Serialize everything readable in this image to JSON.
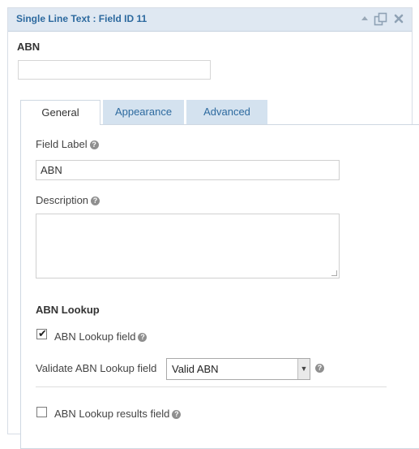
{
  "panel": {
    "title": "Single Line Text : Field ID 11",
    "icons": [
      "collapse-icon",
      "duplicate-icon",
      "close-icon"
    ]
  },
  "field": {
    "name": "ABN",
    "preview_value": ""
  },
  "tabs": [
    {
      "label": "General",
      "active": true
    },
    {
      "label": "Appearance",
      "active": false
    },
    {
      "label": "Advanced",
      "active": false
    }
  ],
  "general": {
    "field_label_title": "Field Label",
    "field_label_value": "ABN",
    "description_title": "Description",
    "description_value": "",
    "abn_lookup_section": "ABN Lookup",
    "abn_lookup_field_label": "ABN Lookup field",
    "abn_lookup_field_checked": true,
    "validate_label": "Validate ABN Lookup field",
    "validate_selected": "Valid ABN",
    "results_field_label": "ABN Lookup results field",
    "results_field_checked": false
  },
  "colors": {
    "header_bg": "#dfe8f2",
    "title_color": "#2d6a9f",
    "inactive_tab_bg": "#d4e2ef"
  }
}
